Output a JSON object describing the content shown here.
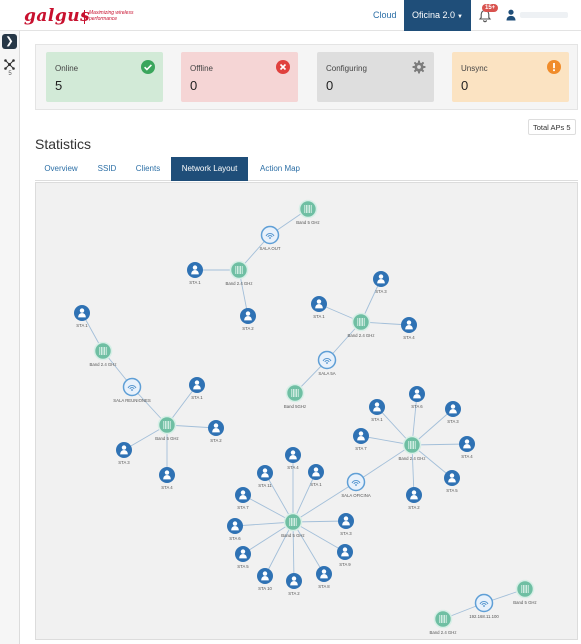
{
  "app": {
    "logo_text": "galgus",
    "tagline": "Maximizing wireless performance",
    "nav_cloud": "Cloud",
    "nav_location": "Oficina 2.0",
    "notification_count": "15+",
    "user_name": "",
    "rail_device_count": "5"
  },
  "status_cards": [
    {
      "label": "Online",
      "value": "5",
      "icon": "check-circle-icon",
      "color": "#3aa65c"
    },
    {
      "label": "Offline",
      "value": "0",
      "icon": "x-circle-icon",
      "color": "#e0413e"
    },
    {
      "label": "Configuring",
      "value": "0",
      "icon": "gear-icon",
      "color": "#7d7d7d"
    },
    {
      "label": "Unsync",
      "value": "0",
      "icon": "exclamation-circle-icon",
      "color": "#f08c2b"
    }
  ],
  "total_aps": "Total APs 5",
  "statistics_title": "Statistics",
  "tabs": [
    "Overview",
    "SSID",
    "Clients",
    "Network Layout",
    "Action Map"
  ],
  "active_tab": "Network Layout",
  "network": {
    "nodes": [
      {
        "id": "b1",
        "type": "band",
        "label": "Band 5 GHz"
      },
      {
        "id": "ap1",
        "type": "ap",
        "label": "SALA OUT"
      },
      {
        "id": "b2",
        "type": "band",
        "label": "Band 2.4 GHz"
      },
      {
        "id": "s2a",
        "type": "sta",
        "label": "STA 1"
      },
      {
        "id": "s2b",
        "type": "sta",
        "label": "STA 2"
      },
      {
        "id": "s3a",
        "type": "sta",
        "label": "STA 3"
      },
      {
        "id": "s3b",
        "type": "sta",
        "label": "STA 1"
      },
      {
        "id": "s3c",
        "type": "sta",
        "label": "STA 4"
      },
      {
        "id": "b3",
        "type": "band",
        "label": "Band 2.4 GHz"
      },
      {
        "id": "ap2",
        "type": "ap",
        "label": "SALA 5A"
      },
      {
        "id": "b4",
        "type": "band",
        "label": "Band 5GHz"
      },
      {
        "id": "s4",
        "type": "sta",
        "label": "STA 1"
      },
      {
        "id": "b5",
        "type": "band",
        "label": "Band 2.4 GHz"
      },
      {
        "id": "ap3",
        "type": "ap",
        "label": "SALA REUNIONES"
      },
      {
        "id": "b6",
        "type": "band",
        "label": "Band 5 GHz"
      },
      {
        "id": "s6a",
        "type": "sta",
        "label": "STA 1"
      },
      {
        "id": "s6b",
        "type": "sta",
        "label": "STA 2"
      },
      {
        "id": "s6c",
        "type": "sta",
        "label": "STA 3"
      },
      {
        "id": "s6d",
        "type": "sta",
        "label": "STA 4"
      },
      {
        "id": "b7",
        "type": "band",
        "label": "Band 2.4 GHz"
      },
      {
        "id": "s7a",
        "type": "sta",
        "label": "STA 1"
      },
      {
        "id": "s7b",
        "type": "sta",
        "label": "STA 6"
      },
      {
        "id": "s7c",
        "type": "sta",
        "label": "STA 3"
      },
      {
        "id": "s7d",
        "type": "sta",
        "label": "STA 7"
      },
      {
        "id": "s7e",
        "type": "sta",
        "label": "STA 4"
      },
      {
        "id": "s7f",
        "type": "sta",
        "label": "STA 5"
      },
      {
        "id": "s7g",
        "type": "sta",
        "label": "STA 2"
      },
      {
        "id": "ap4",
        "type": "ap",
        "label": "SALA OFICINA"
      },
      {
        "id": "b8",
        "type": "band",
        "label": "Band 5 GHz"
      },
      {
        "id": "s8a",
        "type": "sta",
        "label": "STA 11"
      },
      {
        "id": "s8b",
        "type": "sta",
        "label": "STA 4"
      },
      {
        "id": "s8c",
        "type": "sta",
        "label": "STA 1"
      },
      {
        "id": "s8d",
        "type": "sta",
        "label": "STA 7"
      },
      {
        "id": "s8e",
        "type": "sta",
        "label": "STA 3"
      },
      {
        "id": "s8f",
        "type": "sta",
        "label": "STA 9"
      },
      {
        "id": "s8g",
        "type": "sta",
        "label": "STA 6"
      },
      {
        "id": "s8h",
        "type": "sta",
        "label": "STA 8"
      },
      {
        "id": "s8i",
        "type": "sta",
        "label": "STA 10"
      },
      {
        "id": "s8j",
        "type": "sta",
        "label": "STA 5"
      },
      {
        "id": "s8k",
        "type": "sta",
        "label": "STA 2"
      },
      {
        "id": "ap5",
        "type": "ap",
        "label": "192.168.11.100"
      },
      {
        "id": "b9",
        "type": "band",
        "label": "Band 5 GHz"
      },
      {
        "id": "b10",
        "type": "band",
        "label": "Band 2.4 GHz"
      }
    ],
    "links": [
      [
        "b1",
        "ap1"
      ],
      [
        "ap1",
        "b2"
      ],
      [
        "b2",
        "s2a"
      ],
      [
        "b2",
        "s2b"
      ],
      [
        "s3a",
        "b3"
      ],
      [
        "s3b",
        "b3"
      ],
      [
        "s3c",
        "b3"
      ],
      [
        "b3",
        "ap2"
      ],
      [
        "ap2",
        "b4"
      ],
      [
        "s4",
        "b5"
      ],
      [
        "b5",
        "ap3"
      ],
      [
        "ap3",
        "b6"
      ],
      [
        "b6",
        "s6a"
      ],
      [
        "b6",
        "s6b"
      ],
      [
        "b6",
        "s6c"
      ],
      [
        "b6",
        "s6d"
      ],
      [
        "b7",
        "s7a"
      ],
      [
        "b7",
        "s7b"
      ],
      [
        "b7",
        "s7c"
      ],
      [
        "b7",
        "s7d"
      ],
      [
        "b7",
        "s7e"
      ],
      [
        "b7",
        "s7f"
      ],
      [
        "b7",
        "s7g"
      ],
      [
        "b7",
        "ap4"
      ],
      [
        "ap4",
        "b8"
      ],
      [
        "b8",
        "s8a"
      ],
      [
        "b8",
        "s8b"
      ],
      [
        "b8",
        "s8c"
      ],
      [
        "b8",
        "s8d"
      ],
      [
        "b8",
        "s8e"
      ],
      [
        "b8",
        "s8f"
      ],
      [
        "b8",
        "s8g"
      ],
      [
        "b8",
        "s8h"
      ],
      [
        "b8",
        "s8i"
      ],
      [
        "b8",
        "s8j"
      ],
      [
        "b8",
        "s8k"
      ],
      [
        "b9",
        "ap5"
      ],
      [
        "ap5",
        "b10"
      ]
    ]
  }
}
